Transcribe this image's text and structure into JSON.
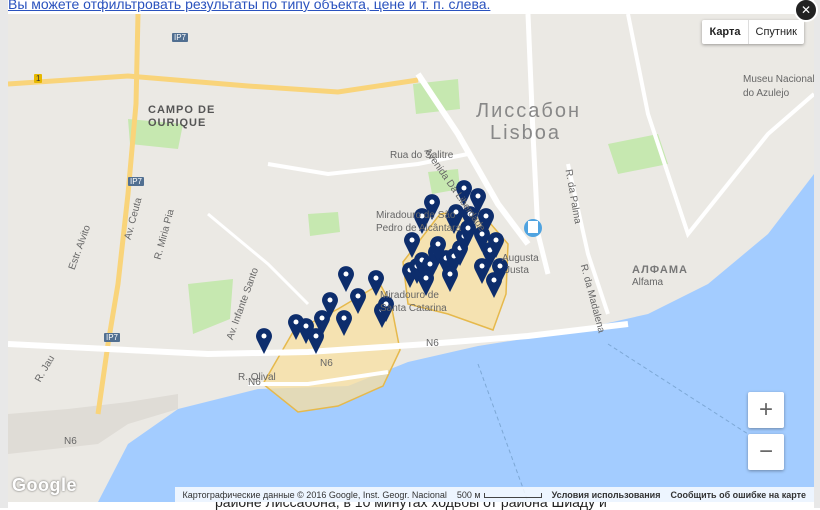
{
  "background": {
    "top_text": "Вы можете отфильтровать результаты по типу объекта, цене и т. п. слева.",
    "bottom_text": "районе Лиссабона, в 10 минутах ходьбы от района Шиаду и"
  },
  "map": {
    "map_type_map": "Карта",
    "map_type_satellite": "Спутник",
    "zoom_in": "+",
    "zoom_out": "−",
    "close": "✕",
    "logo": "Google",
    "attribution": "Картографические данные © 2016 Google, Inst. Geogr. Nacional",
    "scale": "500 м",
    "terms": "Условия использования",
    "report": "Сообщить об ошибке на карте",
    "labels": {
      "city_ru": "Лиссабон",
      "city_pt": "Lisboa",
      "campo_1": "CAMPO DE",
      "campo_2": "OURIQUE",
      "alfama_ru": "АЛФАМА",
      "alfama_pt": "Alfama",
      "museu_1": "Museu Nacional",
      "museu_2": "do Azulejo",
      "miradouro_1": "Miradouro de São",
      "miradouro_2": "Pedro de Alcântara",
      "catarina_1": "Miradouro de",
      "catarina_2": "Santa Catarina",
      "augusta": "Augusta",
      "justa": "Justa",
      "rua_salitre": "Rua do Salitre",
      "av_liberdade": "Avenida Da Liberdade",
      "av_ceuta": "Av. Ceuta",
      "estr_alvito": "Estr. Alvito",
      "r_mira": "R. Miria Pia",
      "r_janelas": "Av. Infante Santo",
      "r_jau": "R. Jau",
      "r_olival": "R. Olival",
      "r_madalena": "R. da Madalena",
      "r_palma": "R. da Palma",
      "n6_a": "N6",
      "n6_b": "N6",
      "n6_c": "N6",
      "n6_d": "N6",
      "ip7_a": "IP7",
      "ip7_b": "IP7",
      "ip7_c": "IP7",
      "route_1": "1"
    },
    "markers_count": 40,
    "colors": {
      "water": "#a3ccff",
      "park": "#c6e8b0",
      "highlight": "#f8dfa0",
      "highlight_stroke": "#e6b94c",
      "marker": "#0d2d6c",
      "highway": "#f9d47a",
      "land": "#ebe9e4"
    }
  }
}
